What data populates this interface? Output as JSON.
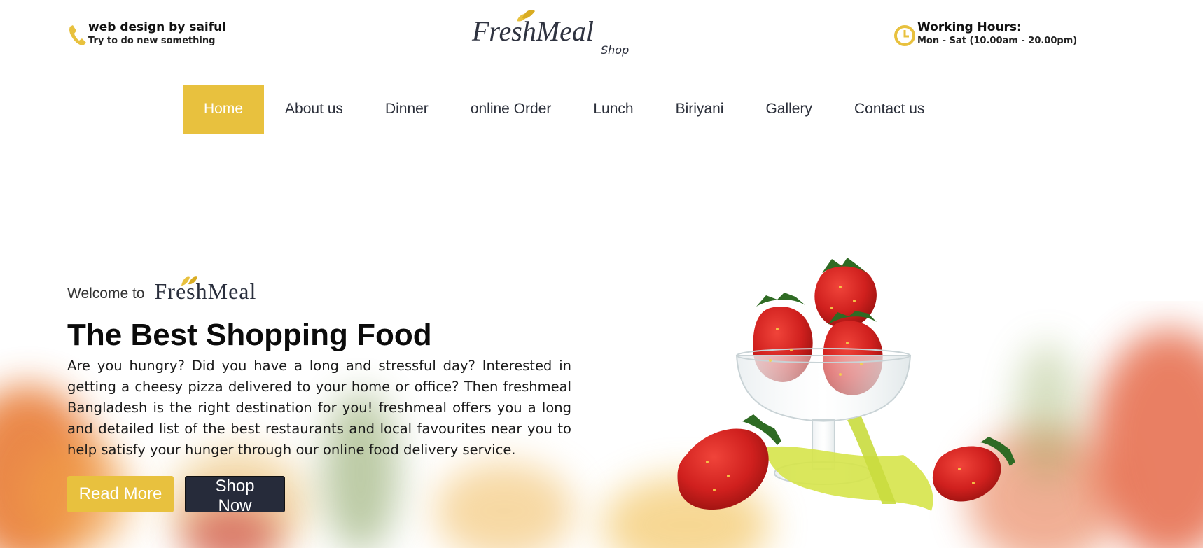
{
  "header": {
    "contact_title": "web design by saiful",
    "contact_subtitle": "Try to do new something",
    "hours_title": "Working Hours:",
    "hours_value": "Mon - Sat (10.00am - 20.00pm)",
    "logo_main": "FreshMeal",
    "logo_sub": "Shop"
  },
  "nav": {
    "items": [
      {
        "label": "Home",
        "active": true
      },
      {
        "label": "About us"
      },
      {
        "label": "Dinner"
      },
      {
        "label": "online Order"
      },
      {
        "label": "Lunch"
      },
      {
        "label": "Biriyani"
      },
      {
        "label": "Gallery"
      },
      {
        "label": "Contact us"
      }
    ]
  },
  "hero": {
    "welcome": "Welcome to",
    "brand": "FreshMeal",
    "headline": "The Best Shopping Food",
    "description": "Are you hungry? Did you have a long and stressful day? Interested in getting a cheesy pizza delivered to your home or office? Then freshmeal Bangladesh is the right destination for you! freshmeal offers you a long and detailed list of the best restaurants and local favourites near you to help satisfy your hunger through our online food delivery service.",
    "read_more": "Read More",
    "shop_now": "Shop Now"
  },
  "icons": {
    "phone": "phone-icon",
    "clock": "clock-icon",
    "leaf": "leaf-icon"
  },
  "colors": {
    "accent": "#e8c13e",
    "dark": "#262b3a",
    "nav_text": "#2b2f3a"
  }
}
